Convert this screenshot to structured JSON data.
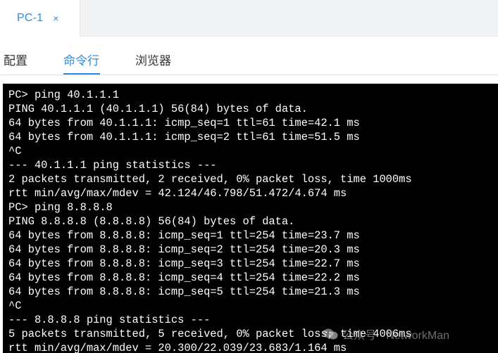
{
  "session": {
    "tab_label": "PC-1",
    "close_glyph": "×"
  },
  "tabs": [
    {
      "label": "配置",
      "active": false
    },
    {
      "label": "命令行",
      "active": true
    },
    {
      "label": "浏览器",
      "active": false
    }
  ],
  "terminal": {
    "lines": [
      "PC> ping 40.1.1.1",
      "PING 40.1.1.1 (40.1.1.1) 56(84) bytes of data.",
      "64 bytes from 40.1.1.1: icmp_seq=1 ttl=61 time=42.1 ms",
      "64 bytes from 40.1.1.1: icmp_seq=2 ttl=61 time=51.5 ms",
      "^C",
      "--- 40.1.1.1 ping statistics ---",
      "2 packets transmitted, 2 received, 0% packet loss, time 1000ms",
      "rtt min/avg/max/mdev = 42.124/46.798/51.472/4.674 ms",
      "PC> ping 8.8.8.8",
      "PING 8.8.8.8 (8.8.8.8) 56(84) bytes of data.",
      "64 bytes from 8.8.8.8: icmp_seq=1 ttl=254 time=23.7 ms",
      "64 bytes from 8.8.8.8: icmp_seq=2 ttl=254 time=20.3 ms",
      "64 bytes from 8.8.8.8: icmp_seq=3 ttl=254 time=22.7 ms",
      "64 bytes from 8.8.8.8: icmp_seq=4 ttl=254 time=22.2 ms",
      "64 bytes from 8.8.8.8: icmp_seq=5 ttl=254 time=21.3 ms",
      "^C",
      "--- 8.8.8.8 ping statistics ---",
      "5 packets transmitted, 5 received, 0% packet loss, time 4006ms",
      "rtt min/avg/max/mdev = 20.300/22.039/23.683/1.164 ms"
    ]
  },
  "watermark": {
    "text": "公众号 · NetworkMan",
    "icon": "wechat-icon"
  },
  "colors": {
    "accent": "#2f8ce0",
    "terminal_bg": "#000000",
    "terminal_fg": "#ffffff"
  }
}
